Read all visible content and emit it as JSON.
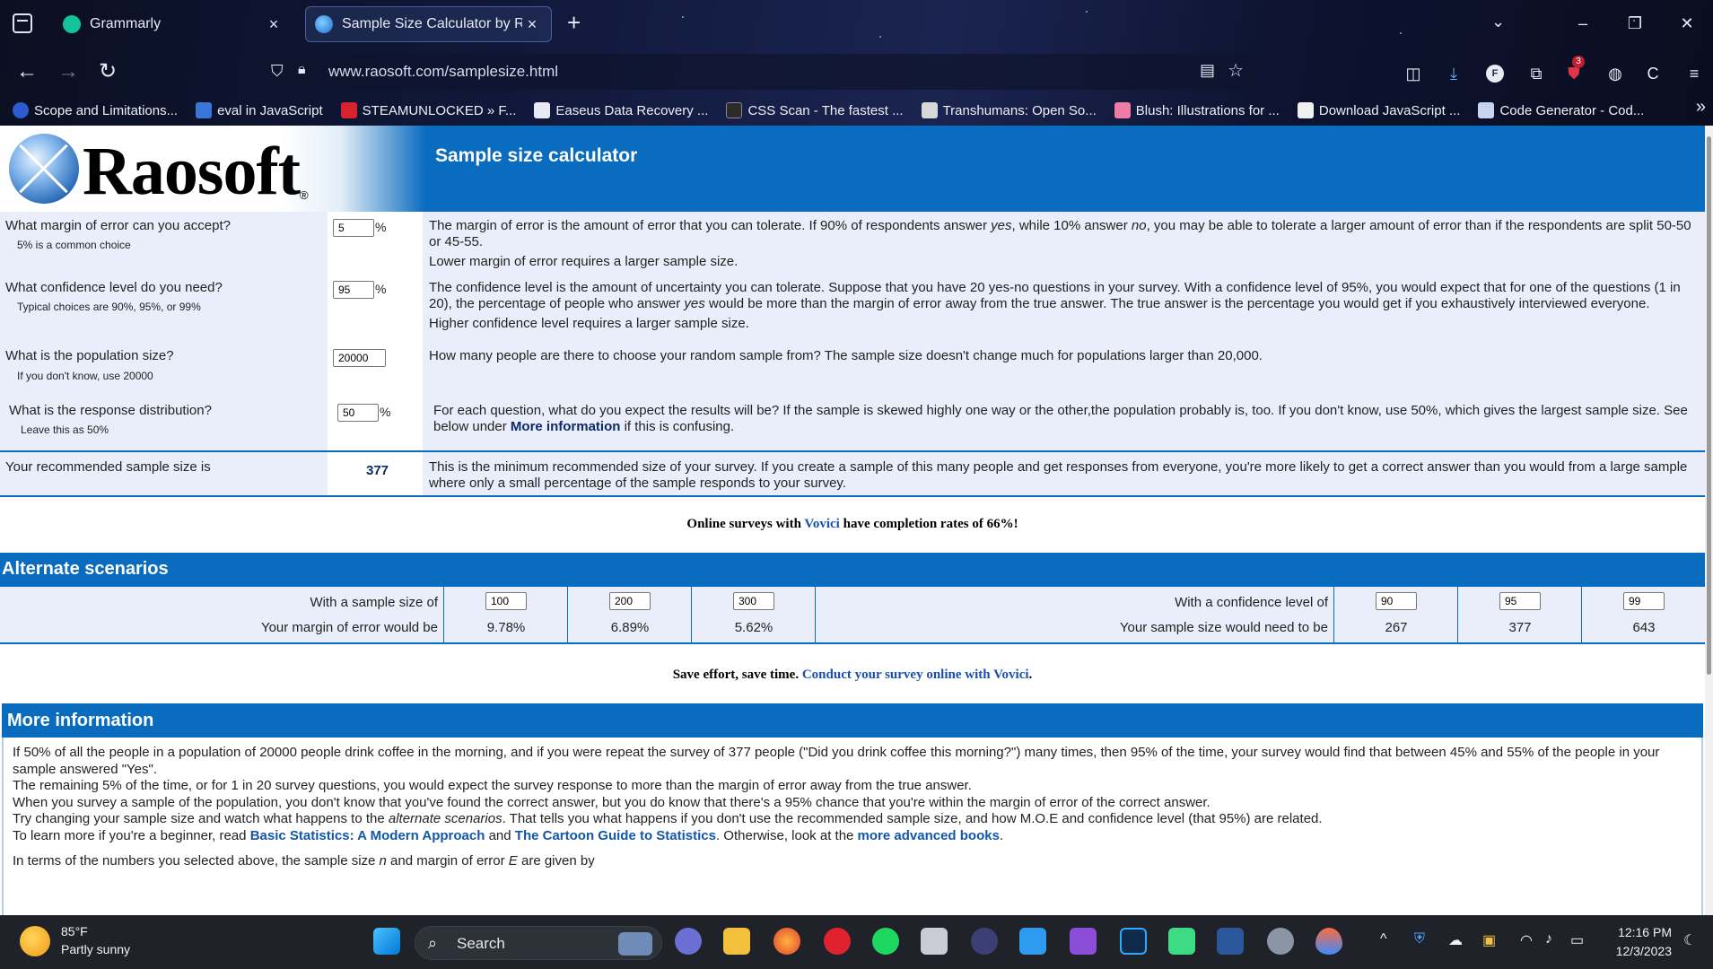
{
  "browser": {
    "tabs": [
      {
        "title": "Grammarly",
        "active": false
      },
      {
        "title": "Sample Size Calculator by Raosoft",
        "active": true
      }
    ],
    "url": "www.raosoft.com/samplesize.html",
    "bookmarks": [
      "Scope and Limitations...",
      "eval in JavaScript",
      "STEAMUNLOCKED » F...",
      "Easeus Data Recovery ...",
      "CSS Scan - The fastest ...",
      "Transhumans: Open So...",
      "Blush: Illustrations for ...",
      "Download JavaScript ...",
      "Code Generator - Cod..."
    ],
    "notification_count": "3"
  },
  "page": {
    "logo_text": "Raosoft",
    "logo_reg": "®",
    "title": "Sample size calculator",
    "calculator": {
      "margin": {
        "question": "What margin of error can you accept?",
        "hint": "5% is a common choice",
        "value": "5",
        "unit": "%",
        "desc1_pre": "The margin of error is the amount of error that you can tolerate. If 90% of respondents answer ",
        "desc1_yes": "yes",
        "desc1_mid": ", while 10% answer ",
        "desc1_no": "no",
        "desc1_post": ", you may be able to tolerate a larger amount of error than if the respondents are split 50-50 or 45-55.",
        "desc2": "Lower margin of error requires a larger sample size."
      },
      "confidence": {
        "question": "What confidence level do you need?",
        "hint": "Typical choices are 90%, 95%, or 99%",
        "value": "95",
        "unit": "%",
        "desc1_pre": "The confidence level is the amount of uncertainty you can tolerate. Suppose that you have 20 yes-no questions in your survey. With a confidence level of 95%, you would expect that for one of the questions (1 in 20), the percentage of people who answer ",
        "desc1_yes": "yes",
        "desc1_post": " would be more than the margin of error away from the true answer. The true answer is the percentage you would get if you exhaustively interviewed everyone.",
        "desc2": "Higher confidence level requires a larger sample size."
      },
      "population": {
        "question": "What is the population size?",
        "hint": "If you don't know, use 20000",
        "value": "20000",
        "desc": "How many people are there to choose your random sample from? The sample size doesn't change much for populations larger than 20,000."
      },
      "distribution": {
        "question": "What is the response distribution?",
        "hint": "Leave this as 50%",
        "value": "50",
        "unit": "%",
        "desc_pre": "For each question, what do you expect the results will be? If the sample is skewed highly one way or the other,the population probably is, too. If you don't know, use 50%, which gives the largest sample size. See below under ",
        "desc_link": "More information",
        "desc_post": " if this is confusing."
      },
      "result": {
        "label": "Your recommended sample size is",
        "value": "377",
        "desc": "This is the minimum recommended size of your survey. If you create a sample of this many people and get responses from everyone, you're more likely to get a correct answer than you would from a large sample where only a small percentage of the sample responds to your survey."
      }
    },
    "promo1": {
      "pre": "Online surveys with ",
      "link": "Vovici",
      "post": " have completion rates of 66%!"
    },
    "alternate": {
      "heading": "Alternate scenarios",
      "sample_label": "With a sample size of",
      "margin_label": "Your margin of error would be",
      "samples": [
        "100",
        "200",
        "300"
      ],
      "margins": [
        "9.78%",
        "6.89%",
        "5.62%"
      ],
      "conf_label": "With a confidence level of",
      "size_label": "Your sample size would need to be",
      "confs": [
        "90",
        "95",
        "99"
      ],
      "sizes": [
        "267",
        "377",
        "643"
      ]
    },
    "promo2": {
      "pre": "Save effort, save time. ",
      "link": "Conduct your survey online with Vovici",
      "post": "."
    },
    "more": {
      "heading": "More information",
      "p1": "If 50% of all the people in a population of 20000 people drink coffee in the morning, and if you were repeat the survey of 377 people (\"Did you drink coffee this morning?\") many times, then 95% of the time, your survey would find that between 45% and 55% of the people in your sample answered \"Yes\".",
      "p2": "The remaining 5% of the time, or for 1 in 20 survey questions, you would expect the survey response to more than the margin of error away from the true answer.",
      "p3": "When you survey a sample of the population, you don't know that you've found the correct answer, but you do know that there's a 95% chance that you're within the margin of error of the correct answer.",
      "p4_pre": "Try changing your sample size and watch what happens to the ",
      "p4_em": "alternate scenarios",
      "p4_post": ". That tells you what happens if you don't use the recommended sample size, and how M.O.E and confidence level (that 95%) are related.",
      "p5_pre": "To learn more if you're a beginner, read ",
      "p5_link1": "Basic Statistics: A Modern Approach",
      "p5_and": " and ",
      "p5_link2": "The Cartoon Guide to Statistics",
      "p5_mid": ". Otherwise, look at the ",
      "p5_link3": "more advanced books",
      "p5_post": ".",
      "p6_pre": "In terms of the numbers you selected above, the sample size ",
      "p6_n": "n",
      "p6_mid": " and margin of error ",
      "p6_e": "E",
      "p6_post": " are given by"
    }
  },
  "taskbar": {
    "temp": "85°F",
    "weather": "Partly sunny",
    "search": "Search",
    "time": "12:16 PM",
    "date": "12/3/2023"
  },
  "colors": {
    "raosoft_blue": "#0a6cbf",
    "calc_bg": "#e9eefa",
    "link": "#1357a8"
  }
}
